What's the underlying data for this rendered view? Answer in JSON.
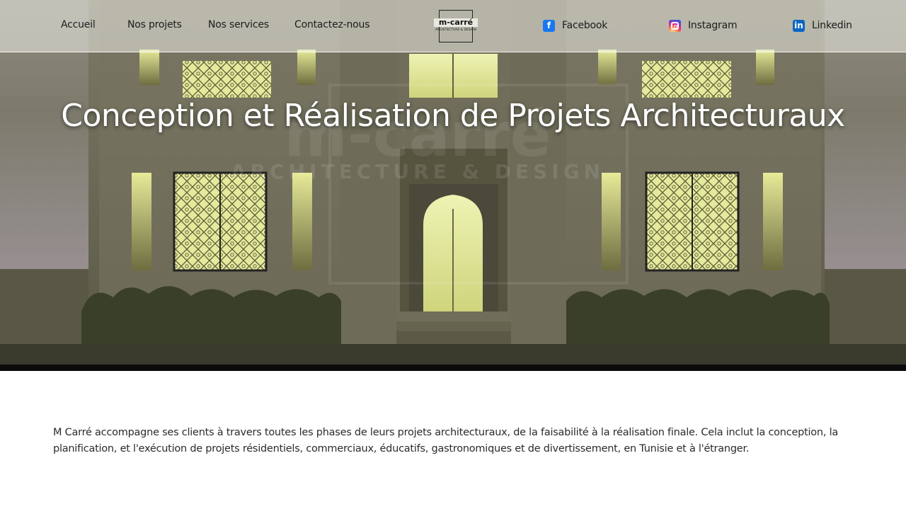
{
  "nav": {
    "links": [
      {
        "label": "Accueil"
      },
      {
        "label": "Nos projets"
      },
      {
        "label": "Nos services"
      },
      {
        "label": "Contactez-nous"
      }
    ],
    "logo": {
      "name": "m-carré",
      "tagline": "ARCHITECTURE & DESIGN"
    },
    "social": [
      {
        "label": "Facebook",
        "icon": "facebook-icon",
        "color": "#1877f2"
      },
      {
        "label": "Instagram",
        "icon": "instagram-icon",
        "color": "#d6249f"
      },
      {
        "label": "Linkedin",
        "icon": "linkedin-icon",
        "color": "#0a66c2"
      }
    ]
  },
  "hero": {
    "title": "Conception et Réalisation de Projets Architecturaux",
    "watermark_line1": "m-carré",
    "watermark_line2": "ARCHITECTURE & DESIGN"
  },
  "description": {
    "text": "M Carré accompagne ses clients à travers toutes les phases de leurs projets architecturaux, de la faisabilité à la réalisation finale. Cela inclut la conception, la planification, et l'exécution de projets résidentiels, commerciaux, éducatifs, gastronomiques et de divertissement, en Tunisie et à l'étranger."
  }
}
